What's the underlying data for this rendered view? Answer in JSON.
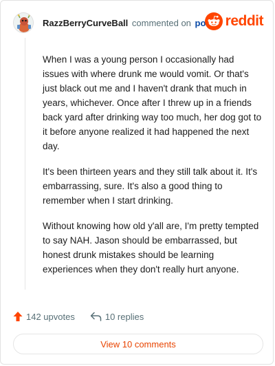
{
  "header": {
    "username": "RazzBerryCurveBall",
    "commented_text": "commented on",
    "post_link": "post",
    "brand": "reddit"
  },
  "comment": {
    "paragraphs": [
      "When I was a young person I occasionally had issues with where drunk me would vomit. Or that's just black out me and I haven't drank that much in years, whichever. Once after I threw up in a friends back yard after drinking way too much, her dog got to it before anyone realized it had happened the next day.",
      "It's been thirteen years and they still talk about it. It's embarrassing, sure. It's also a good thing to remember when I start drinking.",
      "Without knowing how old y'all are, I'm pretty tempted to say NAH. Jason should be embarrassed, but honest drunk mistakes should be learning experiences when they don't really hurt anyone."
    ]
  },
  "actions": {
    "upvotes": "142 upvotes",
    "replies": "10 replies",
    "view_comments": "View 10 comments"
  },
  "colors": {
    "brand": "#ff4500",
    "link": "#0a4aa6",
    "muted": "#576f76"
  }
}
